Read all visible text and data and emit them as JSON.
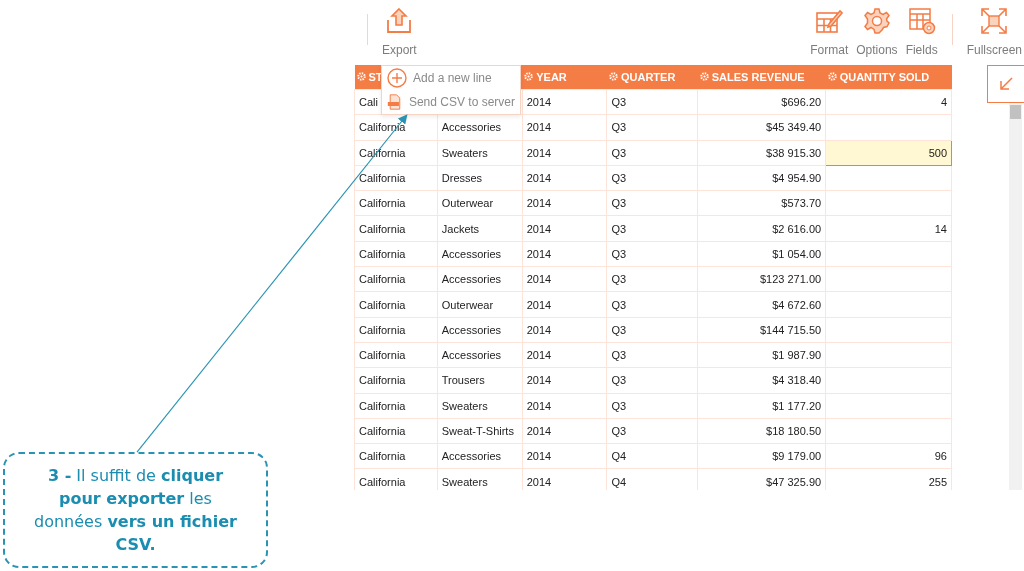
{
  "toolbar": {
    "left": [
      {
        "kind": "export",
        "label": "Export"
      }
    ],
    "right": [
      {
        "kind": "format",
        "label": "Format"
      },
      {
        "kind": "options",
        "label": "Options"
      },
      {
        "kind": "fields",
        "label": "Fields"
      }
    ],
    "fullscreen": {
      "label": "Fullscreen"
    }
  },
  "export_menu": [
    {
      "kind": "add",
      "label": "Add a new line"
    },
    {
      "kind": "csv",
      "label": "Send CSV to server"
    }
  ],
  "table": {
    "columns": [
      {
        "label": "ST"
      },
      {},
      {
        "label": "YEAR"
      },
      {
        "label": "QUARTER"
      },
      {
        "label": "SALES REVENUE"
      },
      {
        "label": "QUANTITY SOLD"
      }
    ],
    "rows": [
      {
        "cells": [
          "Cali",
          null,
          "2014",
          "Q3",
          "$696.20",
          "4"
        ],
        "editing": false
      },
      {
        "cells": [
          "California",
          "Accessories",
          "2014",
          "Q3",
          "$45 349.40",
          null
        ],
        "editing": false
      },
      {
        "cells": [
          "California",
          "Sweaters",
          "2014",
          "Q3",
          "$38 915.30",
          "500"
        ],
        "editing": true
      },
      {
        "cells": [
          "California",
          "Dresses",
          "2014",
          "Q3",
          "$4 954.90",
          null
        ],
        "editing": false
      },
      {
        "cells": [
          "California",
          "Outerwear",
          "2014",
          "Q3",
          "$573.70",
          null
        ],
        "editing": false
      },
      {
        "cells": [
          "California",
          "Jackets",
          "2014",
          "Q3",
          "$2 616.00",
          "14"
        ],
        "editing": false
      },
      {
        "cells": [
          "California",
          "Accessories",
          "2014",
          "Q3",
          "$1 054.00",
          null
        ],
        "editing": false
      },
      {
        "cells": [
          "California",
          "Accessories",
          "2014",
          "Q3",
          "$123 271.00",
          null
        ],
        "editing": false
      },
      {
        "cells": [
          "California",
          "Outerwear",
          "2014",
          "Q3",
          "$4 672.60",
          null
        ],
        "editing": false
      },
      {
        "cells": [
          "California",
          "Accessories",
          "2014",
          "Q3",
          "$144 715.50",
          null
        ],
        "editing": false
      },
      {
        "cells": [
          "California",
          "Accessories",
          "2014",
          "Q3",
          "$1 987.90",
          null
        ],
        "editing": false
      },
      {
        "cells": [
          "California",
          "Trousers",
          "2014",
          "Q3",
          "$4 318.40",
          null
        ],
        "editing": false
      },
      {
        "cells": [
          "California",
          "Sweaters",
          "2014",
          "Q3",
          "$1 177.20",
          null
        ],
        "editing": false
      },
      {
        "cells": [
          "California",
          "Sweat-T-Shirts",
          "2014",
          "Q3",
          "$18 180.50",
          null
        ],
        "editing": false
      },
      {
        "cells": [
          "California",
          "Accessories",
          "2014",
          "Q4",
          "$9 179.00",
          "96"
        ],
        "editing": false
      },
      {
        "cells": [
          "California",
          "Sweaters",
          "2014",
          "Q4",
          "$47 325.90",
          "255"
        ],
        "editing": false
      }
    ]
  },
  "callout": {
    "text": "**3 -** Il suffit de **cliquer pour exporter** les données **vers un fichier CSV.**"
  }
}
